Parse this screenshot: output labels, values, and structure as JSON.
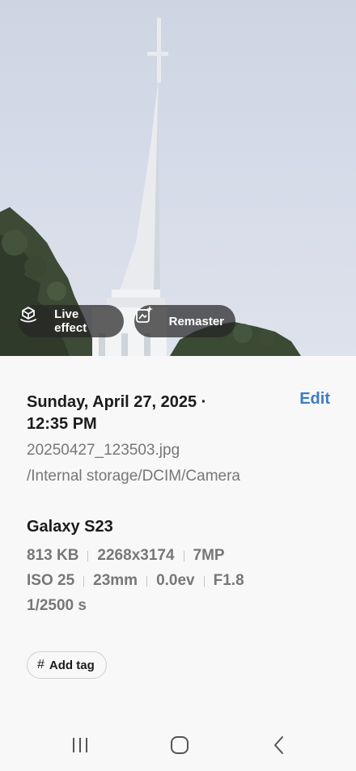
{
  "photo": {
    "actions": [
      {
        "label": "Live effect",
        "icon": "live-effect-icon"
      },
      {
        "label": "Remaster",
        "icon": "remaster-icon"
      }
    ]
  },
  "details": {
    "date_line1": "Sunday, April 27, 2025 ·",
    "date_line2": "12:35 PM",
    "edit_label": "Edit",
    "filename": "20250427_123503.jpg",
    "path": "/Internal storage/DCIM/Camera",
    "device": "Galaxy S23",
    "size": "813 KB",
    "resolution": "2268x3174",
    "megapixels": "7MP",
    "iso": "ISO 25",
    "focal_length": "23mm",
    "exposure": "0.0ev",
    "aperture": "F1.8",
    "shutter": "1/2500 s"
  },
  "tag": {
    "symbol": "#",
    "label": "Add tag"
  },
  "navbar": {
    "icons": [
      "recent-apps-icon",
      "home-icon",
      "back-icon"
    ]
  },
  "colors": {
    "accent": "#3e7cc4",
    "text_primary": "#1b1b1b",
    "text_secondary": "#777777",
    "background": "#f8f8f8"
  }
}
